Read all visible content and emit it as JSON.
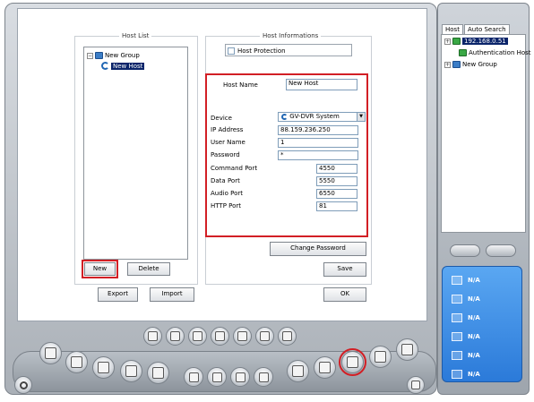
{
  "host_list": {
    "title": "Host List",
    "group": "New Group",
    "host": "New Host",
    "new_label": "New",
    "delete_label": "Delete",
    "export_label": "Export",
    "import_label": "Import"
  },
  "host_info": {
    "title": "Host Informations",
    "protection_label": "Host Protection",
    "host_name_label": "Host Name",
    "host_name_value": "New Host",
    "device_label": "Device",
    "device_value": "GV-DVR System",
    "ip_label": "IP Address",
    "ip_value": "88.159.236.250",
    "user_label": "User Name",
    "user_value": "1",
    "password_label": "Password",
    "password_value": "*",
    "command_port_label": "Command Port",
    "command_port_value": "4550",
    "data_port_label": "Data Port",
    "data_port_value": "5550",
    "audio_port_label": "Audio Port",
    "audio_port_value": "6550",
    "http_port_label": "HTTP Port",
    "http_port_value": "81",
    "change_password_label": "Change Password",
    "save_label": "Save",
    "ok_label": "OK"
  },
  "right_panel": {
    "tab_host": "Host",
    "tab_auto": "Auto Search",
    "tree_ip": "192.168.0.51",
    "tree_auth": "Authentication Host",
    "tree_group": "New Group",
    "status": [
      "N/A",
      "N/A",
      "N/A",
      "N/A",
      "N/A",
      "N/A"
    ]
  },
  "colors": {
    "highlight": "#d21f25",
    "status_panel": "#2b7ad9",
    "selection": "#0a246a"
  }
}
